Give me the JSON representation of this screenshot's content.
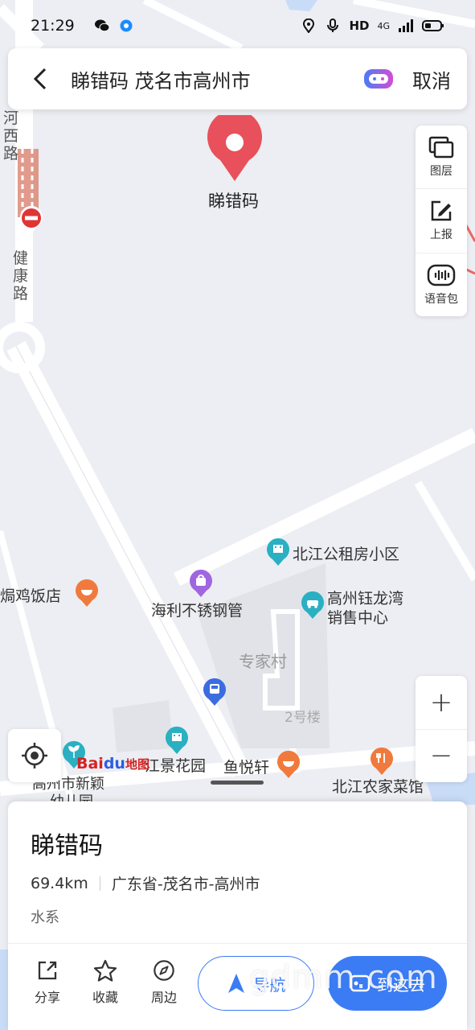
{
  "status_bar": {
    "time": "21:29",
    "network_text": "HD",
    "signal_text": "4G"
  },
  "search": {
    "query": "睇错码 茂名市高州市",
    "cancel_label": "取消"
  },
  "map": {
    "pin_label": "睇错码",
    "roads": [
      "河西路",
      "健康路"
    ],
    "pois": [
      {
        "name": "北江公租房小区",
        "icon": "building-icon",
        "color": "#2ab0c2"
      },
      {
        "name": "海利不锈钢管",
        "icon": "shopping-bag-icon",
        "color": "#a066e0"
      },
      {
        "name": "高州钰龙湾",
        "name2": "销售中心",
        "icon": "car-icon",
        "color": "#2ab0c2"
      },
      {
        "name": "焗鸡饭店",
        "icon": "food-bowl-icon",
        "color": "#f07a3d"
      },
      {
        "name": "专家村",
        "icon": "",
        "color": ""
      },
      {
        "name": "2号楼",
        "icon": "",
        "color": ""
      },
      {
        "name": "江景花园",
        "icon": "building-icon",
        "color": "#2ab0c2"
      },
      {
        "name": "鱼悦轩",
        "icon": "food-bowl-icon",
        "color": "#f07a3d"
      },
      {
        "name": "北江农家菜馆",
        "icon": "fork-knife-icon",
        "color": "#f07a3d"
      },
      {
        "name": "高州市新颖",
        "name2": "幼儿园",
        "icon": "sprout-icon",
        "color": "#2ab0c2"
      }
    ],
    "logo_bai": "Bai",
    "logo_du": "du",
    "logo_map": "地图"
  },
  "tools": [
    {
      "label": "图层",
      "icon": "layers-icon"
    },
    {
      "label": "上报",
      "icon": "report-edit-icon"
    },
    {
      "label": "语音包",
      "icon": "voice-pack-icon"
    }
  ],
  "zoom": {
    "in": "+",
    "out": "−"
  },
  "card": {
    "name": "睇错码",
    "distance": "69.4km",
    "region": "广东省-茂名市-高州市",
    "type": "水系",
    "actions": [
      {
        "label": "分享",
        "icon": "share-icon"
      },
      {
        "label": "收藏",
        "icon": "star-icon"
      },
      {
        "label": "周边",
        "icon": "compass-icon"
      }
    ],
    "nav_label": "导航",
    "go_label": "到这去"
  },
  "watermark": "gdmm.com",
  "colors": {
    "accent": "#3b7cf5",
    "pin": "#e8505b"
  }
}
